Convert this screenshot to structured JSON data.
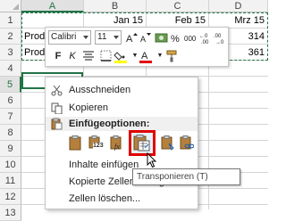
{
  "sheet": {
    "column_headers": [
      "A",
      "B",
      "C",
      "D"
    ],
    "row_headers": [
      "1",
      "2",
      "3",
      "4",
      "5",
      "6",
      "7",
      "8",
      "9",
      "10",
      "11",
      "12",
      "13"
    ],
    "row1": {
      "b": "Jan 15",
      "c": "Feb 15",
      "d": "Mrz 15"
    },
    "row2": {
      "a": "Produ",
      "d": "314"
    },
    "row3": {
      "a": "Produ",
      "d": "361"
    }
  },
  "mini_toolbar": {
    "font_name": "Calibri",
    "font_size": "11",
    "bold": "F",
    "italic": "K",
    "fill_color": "#ffff00",
    "font_color": "#e00000"
  },
  "context_menu": {
    "cut": "Ausschneiden",
    "copy": "Kopieren",
    "paste_options_header": "Einfügeoptionen:",
    "paste_values_label": "123",
    "paste_special": "Inhalte einfügen",
    "insert_copied": "Kopierte Zellen einfügen...",
    "delete_cells": "Zellen löschen..."
  },
  "tooltip": "Transponieren (T)"
}
